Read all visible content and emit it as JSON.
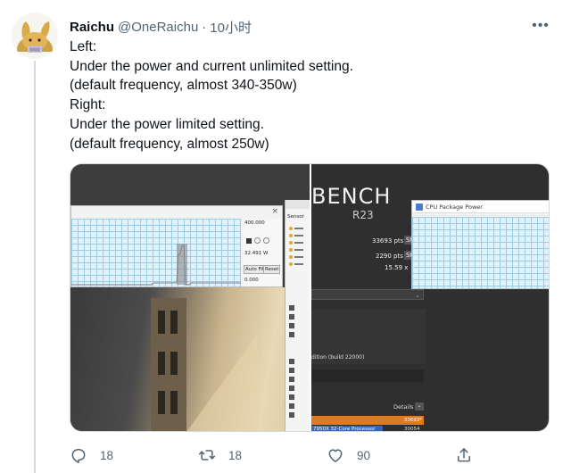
{
  "tweet": {
    "author_name": "Raichu",
    "handle": "@OneRaichu",
    "separator": "·",
    "time": "10小时",
    "more_label": "•••",
    "lines": [
      "Left:",
      "Under the power and current unlimited setting.",
      "(default frequency, almost 340-350w)",
      "Right:",
      "Under the power limited setting.",
      "(default frequency, almost 250w)"
    ]
  },
  "media_left": {
    "graph_close": "×",
    "graph_max": "400.000",
    "graph_value": "32.491 W",
    "graph_auto_fit": "Auto Fit",
    "graph_reset": "Reset",
    "graph_min": "0.000",
    "sensor_header": "Sensor"
  },
  "media_right": {
    "bench_title": "BENCH",
    "bench_version": "R23",
    "score_multi": "33693 pts",
    "score_single": "2290 pts",
    "ratio": "15.59 x",
    "btn_label_1": "St",
    "btn_label_2": "St",
    "build_text": "dition (build 22000)",
    "details_label": "Details",
    "rank_value_1": "33693*",
    "rank_value_2": "30054",
    "rank_label_2": "7950X 32-Core Processor",
    "cpu_power_title": "CPU Package Power"
  },
  "actions": {
    "reply_count": "18",
    "retweet_count": "18",
    "like_count": "90"
  },
  "colors": {
    "text_primary": "#0f1419",
    "text_secondary": "#536471",
    "border": "#cfd9de",
    "accent_orange": "#e07a1f"
  }
}
